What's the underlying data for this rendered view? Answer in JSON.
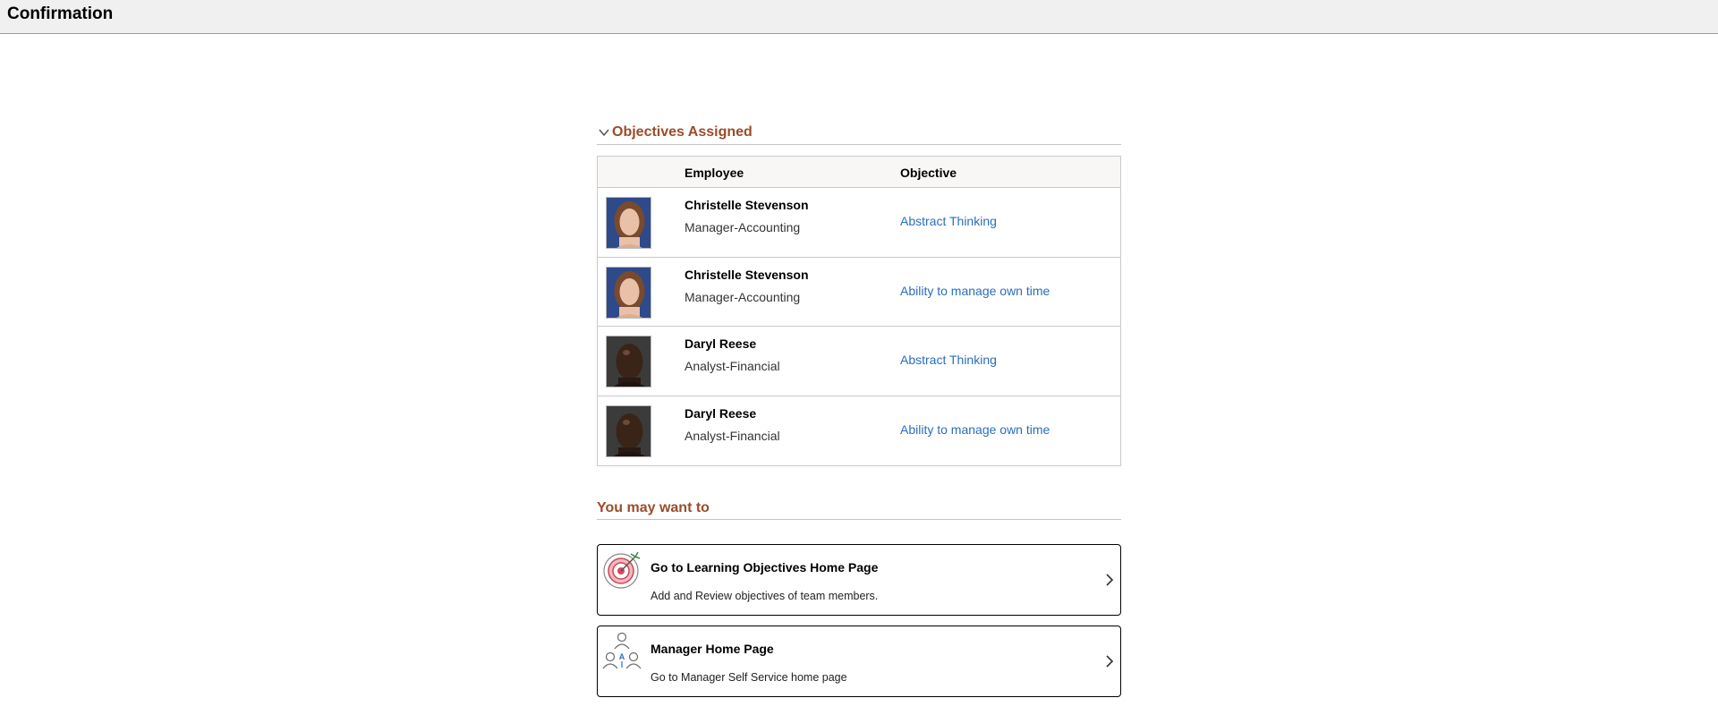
{
  "page": {
    "title": "Confirmation"
  },
  "objectives_section": {
    "heading": "Objectives Assigned",
    "columns": {
      "employee": "Employee",
      "objective": "Objective"
    },
    "rows": [
      {
        "name": "Christelle Stevenson",
        "job_title": "Manager-Accounting",
        "objective": "Abstract Thinking",
        "photo": "female-avatar"
      },
      {
        "name": "Christelle Stevenson",
        "job_title": "Manager-Accounting",
        "objective": "Ability to manage own time",
        "photo": "female-avatar"
      },
      {
        "name": "Daryl Reese",
        "job_title": "Analyst-Financial",
        "objective": "Abstract Thinking",
        "photo": "male-avatar"
      },
      {
        "name": "Daryl Reese",
        "job_title": "Analyst-Financial",
        "objective": "Ability to manage own time",
        "photo": "male-avatar"
      }
    ]
  },
  "you_may_want_to": {
    "heading": "You may want to",
    "cards": [
      {
        "title": "Go to Learning Objectives Home Page",
        "description": "Add and Review objectives of team members.",
        "icon": "target-icon"
      },
      {
        "title": "Manager Home Page",
        "description": "Go to Manager Self Service home page",
        "icon": "team-icon"
      }
    ]
  },
  "colors": {
    "section_heading": "#9a4c2a",
    "link": "#2a6ebb",
    "title_bar": "#f0f0f0"
  }
}
